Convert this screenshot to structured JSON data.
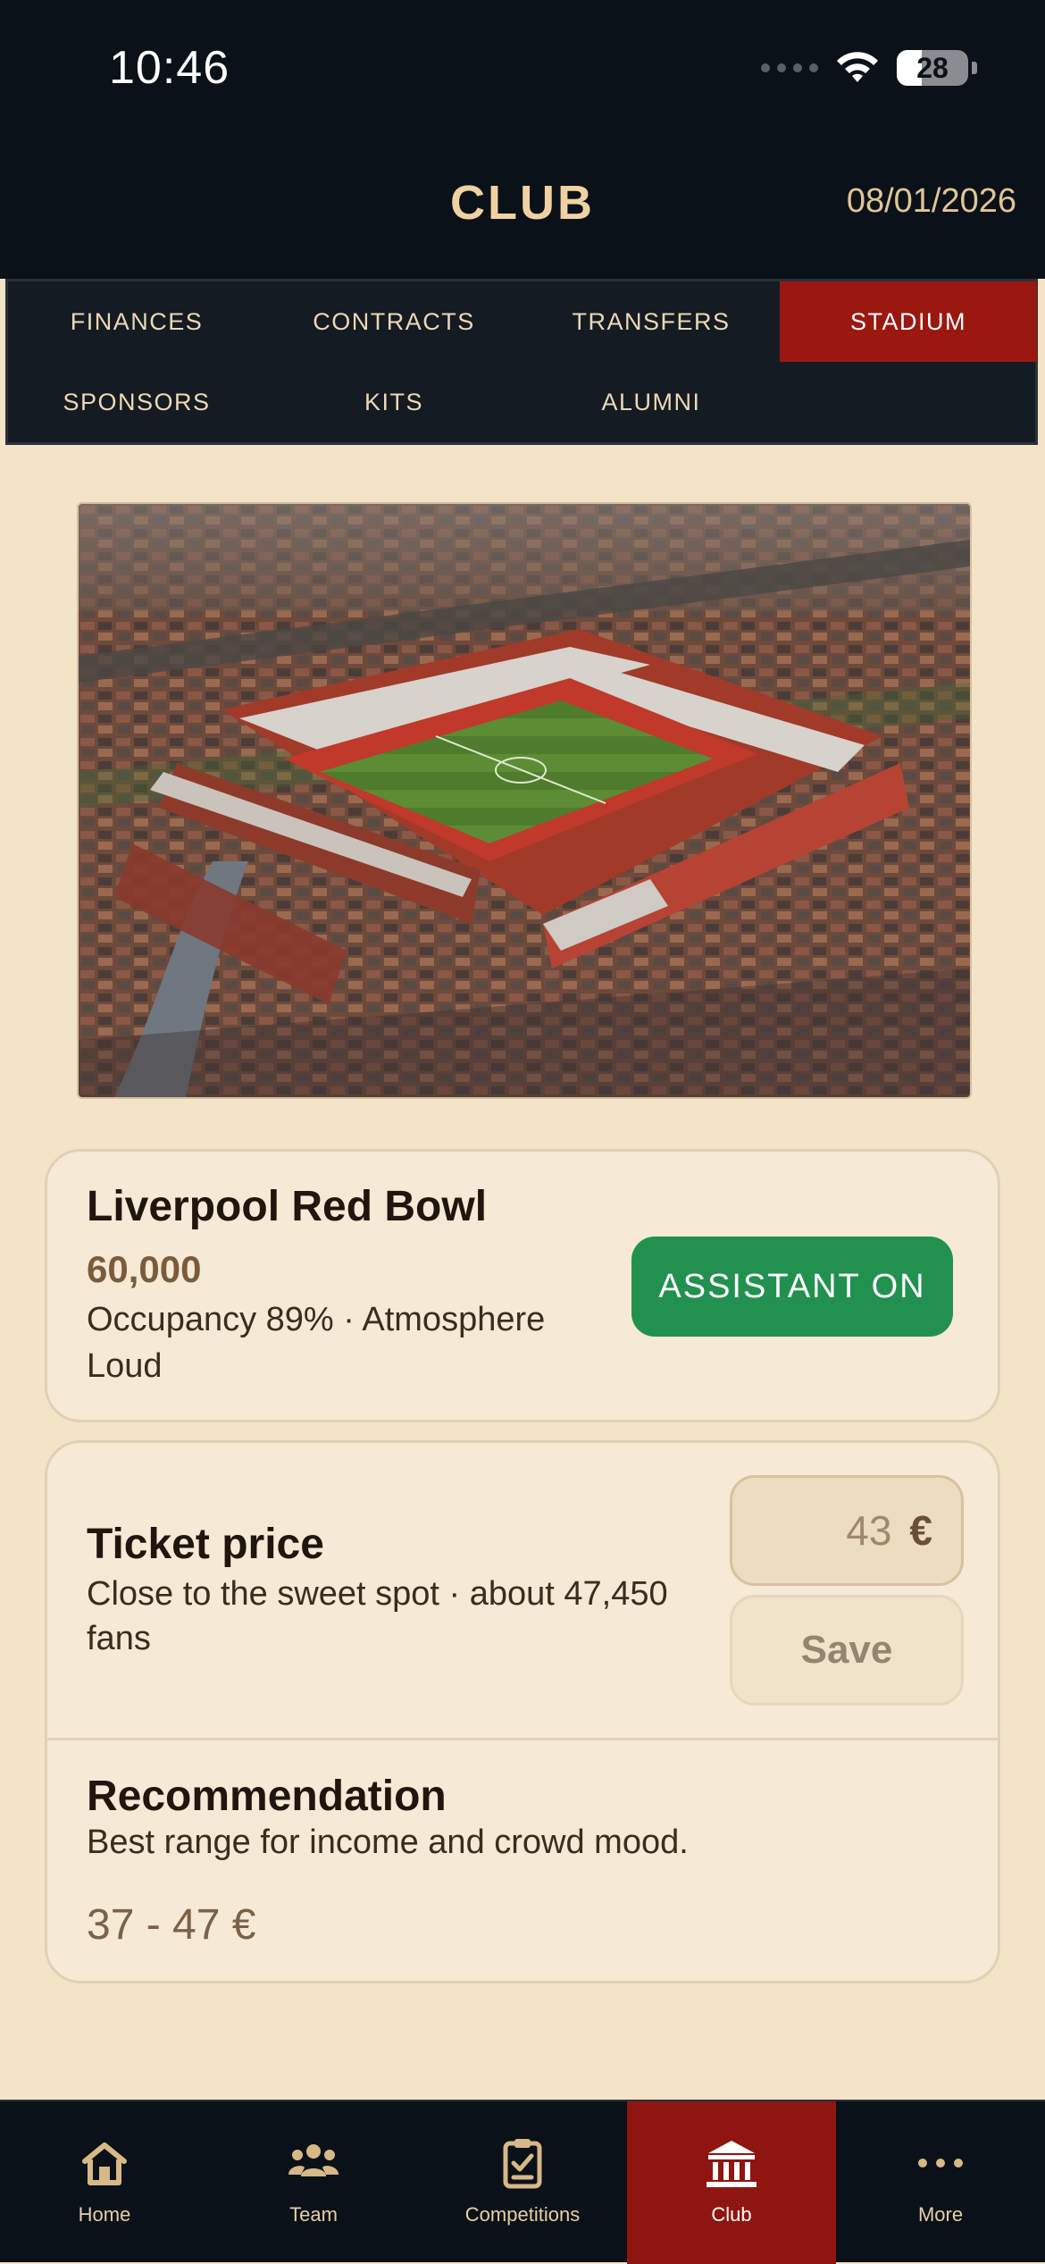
{
  "status_bar": {
    "time": "10:46",
    "battery": "28"
  },
  "header": {
    "title": "CLUB",
    "date": "08/01/2026"
  },
  "tabs": [
    {
      "label": "FINANCES",
      "active": false
    },
    {
      "label": "CONTRACTS",
      "active": false
    },
    {
      "label": "TRANSFERS",
      "active": false
    },
    {
      "label": "STADIUM",
      "active": true
    },
    {
      "label": "SPONSORS",
      "active": false
    },
    {
      "label": "KITS",
      "active": false
    },
    {
      "label": "ALUMNI",
      "active": false
    }
  ],
  "stadium": {
    "name": "Liverpool Red Bowl",
    "capacity": "60,000",
    "meta": "Occupancy 89% · Atmosphere Loud",
    "assistant_label": "ASSISTANT ON"
  },
  "ticket": {
    "title": "Ticket price",
    "description": "Close to the sweet spot · about 47,450 fans",
    "price_value": "43",
    "price_unit": "€",
    "save_label": "Save"
  },
  "recommendation": {
    "title": "Recommendation",
    "description": "Best range for income and crowd mood.",
    "range": "37 - 47 €"
  },
  "bottom_nav": [
    {
      "label": "Home",
      "icon": "home-icon",
      "active": false
    },
    {
      "label": "Team",
      "icon": "team-icon",
      "active": false
    },
    {
      "label": "Competitions",
      "icon": "clipboard-check-icon",
      "active": false
    },
    {
      "label": "Club",
      "icon": "bank-icon",
      "active": true
    },
    {
      "label": "More",
      "icon": "more-icon",
      "active": false
    }
  ],
  "colors": {
    "accent_red": "#9b1810",
    "assistant_green": "#229150",
    "header_bg": "#0b1118",
    "content_bg": "#f3e4c7",
    "gold_text": "#f0d2a2"
  }
}
